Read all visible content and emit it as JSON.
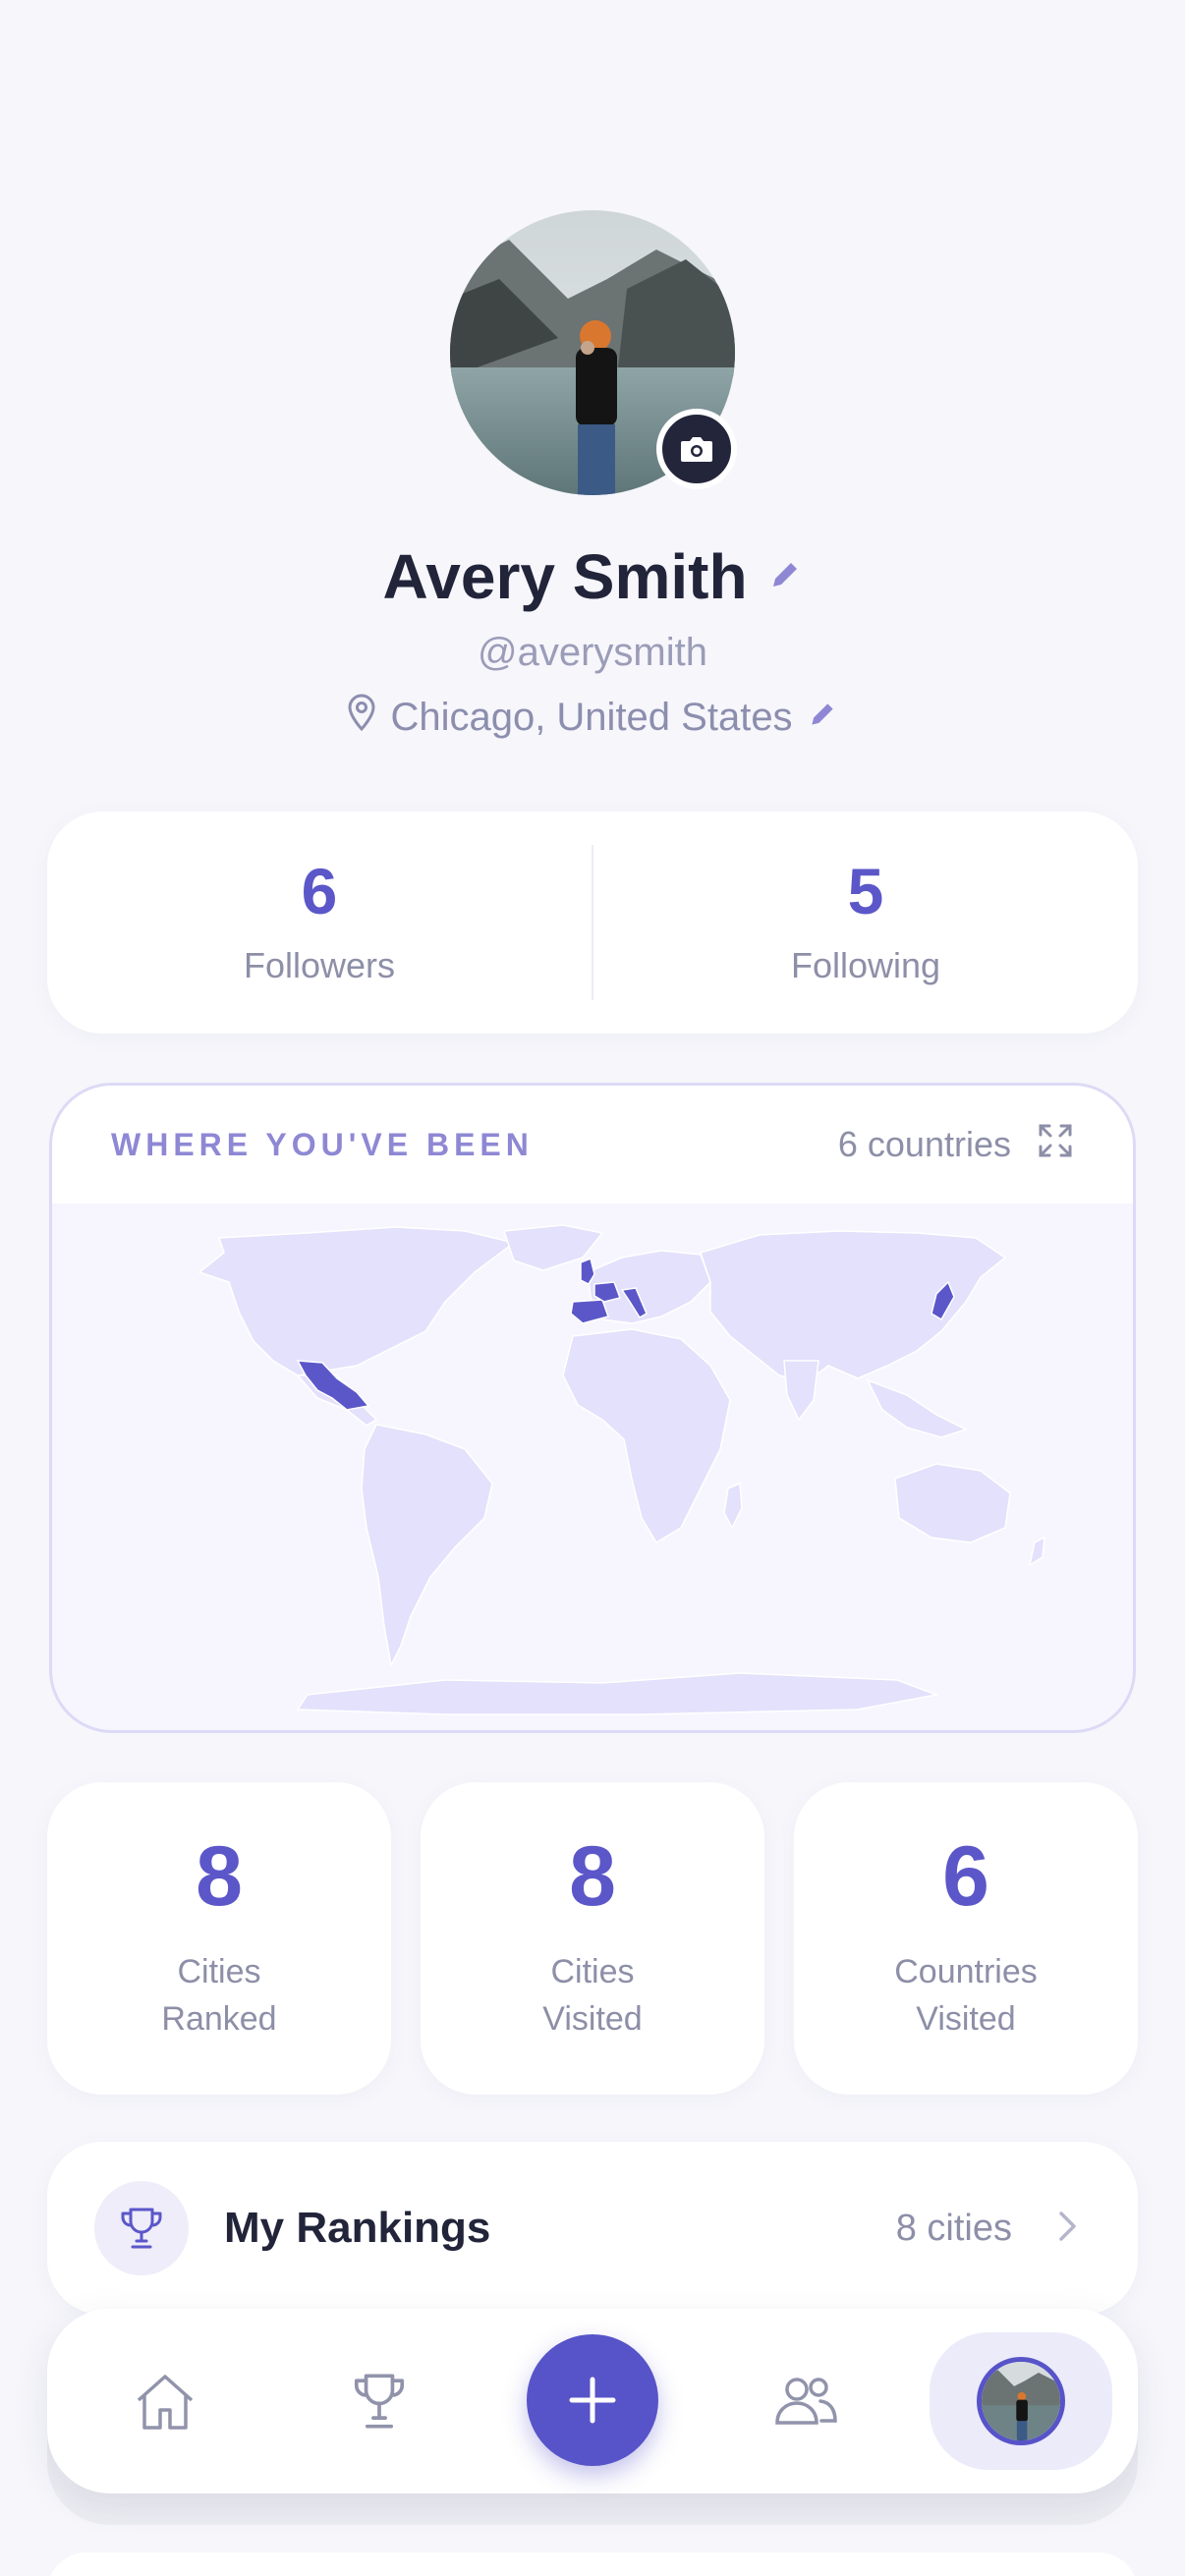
{
  "profile": {
    "name": "Avery Smith",
    "handle": "@averysmith",
    "location": "Chicago, United States"
  },
  "social": {
    "followers_count": "6",
    "followers_label": "Followers",
    "following_count": "5",
    "following_label": "Following"
  },
  "map": {
    "title": "WHERE YOU'VE BEEN",
    "count_label": "6 countries",
    "fill_color": "#e3e1fb",
    "visited_color": "#5b57c9"
  },
  "stats": [
    {
      "value": "8",
      "line1": "Cities",
      "line2": "Ranked"
    },
    {
      "value": "8",
      "line1": "Cities",
      "line2": "Visited"
    },
    {
      "value": "6",
      "line1": "Countries",
      "line2": "Visited"
    }
  ],
  "rankings": {
    "title": "My Rankings",
    "count": "8 cities"
  },
  "nav": {
    "items": [
      "home-icon",
      "trophy-icon",
      "plus-icon",
      "people-icon",
      "profile-avatar"
    ],
    "accent": "#5753c8"
  }
}
